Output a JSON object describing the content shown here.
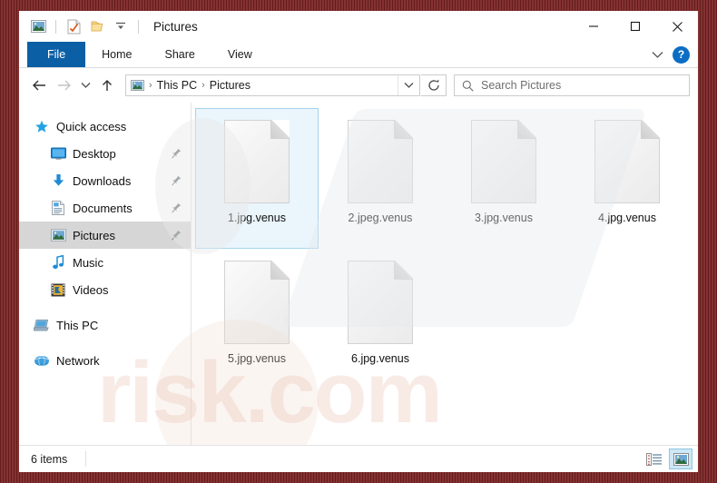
{
  "window": {
    "title": "Pictures",
    "frame_color": "#7b2222",
    "accent_color": "#0b5fa5"
  },
  "quick_access_toolbar": {
    "items": [
      {
        "name": "pictures-library-icon",
        "label": "Pictures library"
      },
      {
        "name": "properties-icon",
        "label": "Properties"
      },
      {
        "name": "new-folder-icon",
        "label": "New folder"
      },
      {
        "name": "customize-toolbar-icon",
        "label": "Customize Quick Access Toolbar"
      }
    ]
  },
  "window_controls": {
    "minimize": "—",
    "maximize": "□",
    "close": "✕",
    "collapse_ribbon": "∨",
    "help": "?"
  },
  "ribbon": {
    "tabs": [
      {
        "label": "File",
        "active": true
      },
      {
        "label": "Home",
        "active": false
      },
      {
        "label": "Share",
        "active": false
      },
      {
        "label": "View",
        "active": false
      }
    ]
  },
  "navigation": {
    "back_label": "Back",
    "forward_label": "Forward",
    "recent_label": "Recent locations",
    "up_label": "Up",
    "refresh_label": "Refresh",
    "dropdown_label": "Previous locations",
    "breadcrumb": [
      {
        "label": "This PC"
      },
      {
        "label": "Pictures"
      }
    ],
    "breadcrumb_separator": "›"
  },
  "search": {
    "placeholder": "Search Pictures",
    "value": ""
  },
  "sidebar": {
    "items": [
      {
        "label": "Quick access",
        "icon": "star-icon",
        "indent": 0,
        "pinned": false,
        "selected": false
      },
      {
        "label": "Desktop",
        "icon": "desktop-icon",
        "indent": 1,
        "pinned": true,
        "selected": false
      },
      {
        "label": "Downloads",
        "icon": "downloads-icon",
        "indent": 1,
        "pinned": true,
        "selected": false
      },
      {
        "label": "Documents",
        "icon": "documents-icon",
        "indent": 1,
        "pinned": true,
        "selected": false
      },
      {
        "label": "Pictures",
        "icon": "pictures-icon",
        "indent": 1,
        "pinned": true,
        "selected": true
      },
      {
        "label": "Music",
        "icon": "music-icon",
        "indent": 1,
        "pinned": false,
        "selected": false
      },
      {
        "label": "Videos",
        "icon": "videos-icon",
        "indent": 1,
        "pinned": false,
        "selected": false
      },
      {
        "label": "This PC",
        "icon": "this-pc-icon",
        "indent": 0,
        "pinned": false,
        "selected": false
      },
      {
        "label": "Network",
        "icon": "network-icon",
        "indent": 0,
        "pinned": false,
        "selected": false
      }
    ]
  },
  "files": [
    {
      "name": "1.jpg.venus",
      "icon": "blank-document-icon",
      "selected": true
    },
    {
      "name": "2.jpeg.venus",
      "icon": "blank-document-icon",
      "selected": false
    },
    {
      "name": "3.jpg.venus",
      "icon": "blank-document-icon",
      "selected": false
    },
    {
      "name": "4.jpg.venus",
      "icon": "blank-document-icon",
      "selected": false
    },
    {
      "name": "5.jpg.venus",
      "icon": "blank-document-icon",
      "selected": false
    },
    {
      "name": "6.jpg.venus",
      "icon": "blank-document-icon",
      "selected": false
    }
  ],
  "statusbar": {
    "item_count": "6 items",
    "views": [
      {
        "name": "details-view-button",
        "label": "Details view",
        "active": false
      },
      {
        "name": "large-icons-view-button",
        "label": "Large icons view",
        "active": true
      }
    ]
  },
  "watermark": {
    "text": "risk.com"
  }
}
